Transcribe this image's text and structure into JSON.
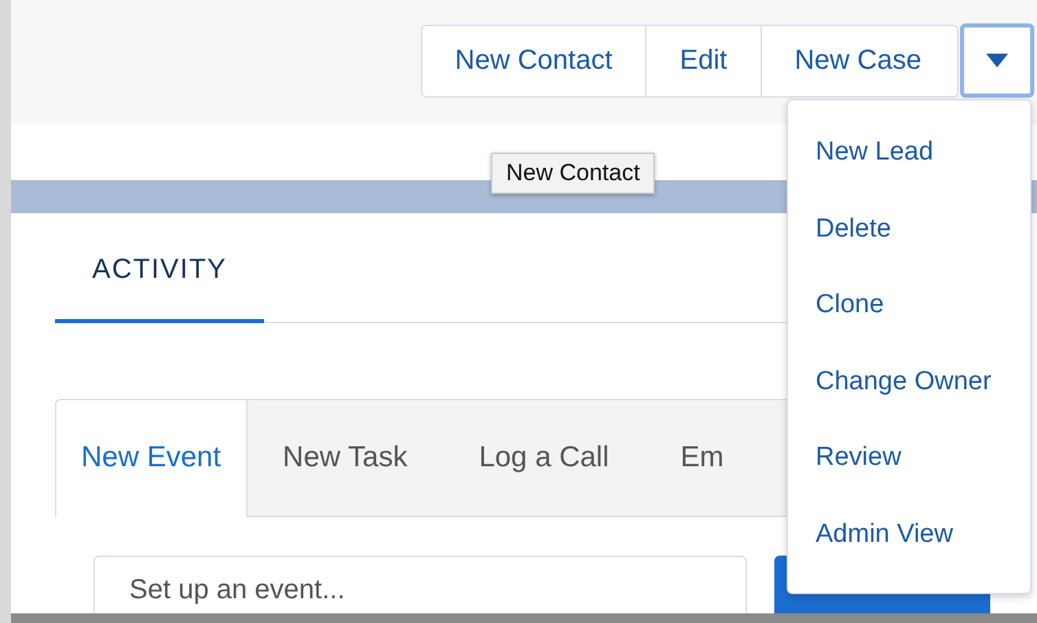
{
  "header_buttons": [
    {
      "label": "New Contact"
    },
    {
      "label": "Edit"
    },
    {
      "label": "New Case"
    }
  ],
  "more_button": {
    "expanded": true
  },
  "tooltip": "New Contact",
  "menu": [
    "New Lead",
    "Delete",
    "Clone",
    "Change Owner",
    "Review",
    "Admin View"
  ],
  "section_tab": {
    "label": "ACTIVITY",
    "selected": true
  },
  "activity_tabs": [
    {
      "label": "New Event",
      "selected": true
    },
    {
      "label": "New Task",
      "selected": false
    },
    {
      "label": "Log a Call",
      "selected": false
    },
    {
      "label": "Em",
      "selected": false
    }
  ],
  "event_input": {
    "placeholder": "Set up an event..."
  }
}
